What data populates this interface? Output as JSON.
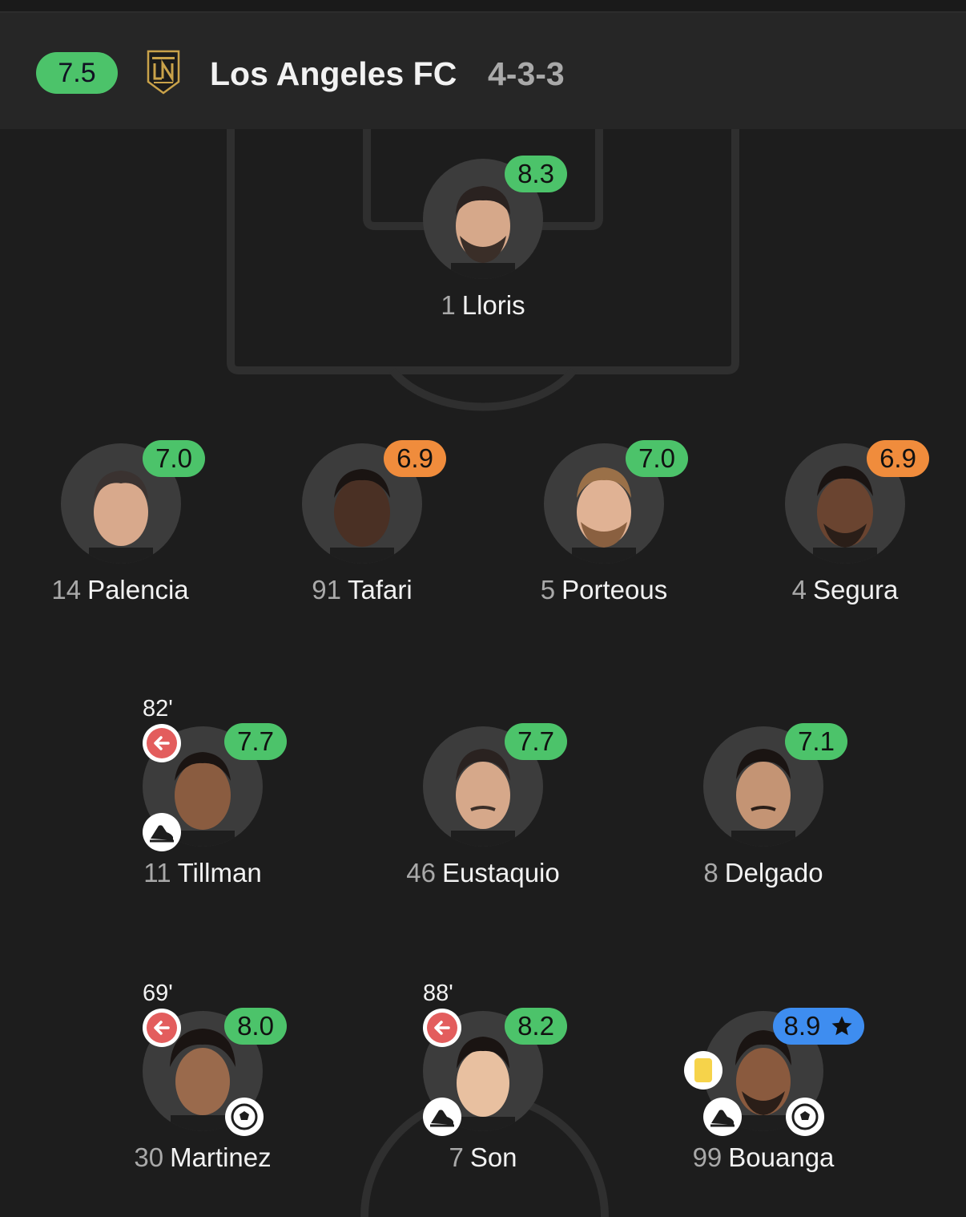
{
  "header": {
    "team_rating": "7.5",
    "team_name": "Los Angeles FC",
    "formation": "4-3-3"
  },
  "colors": {
    "rating_green": "#4cc36a",
    "rating_orange": "#f08c3c",
    "rating_blue": "#3e8df0",
    "sub_red": "#e35d5d",
    "yellow_card": "#f6d34a"
  },
  "players": {
    "lloris": {
      "number": "1",
      "name": "Lloris",
      "rating": "8.3"
    },
    "palencia": {
      "number": "14",
      "name": "Palencia",
      "rating": "7.0"
    },
    "tafari": {
      "number": "91",
      "name": "Tafari",
      "rating": "6.9"
    },
    "porteous": {
      "number": "5",
      "name": "Porteous",
      "rating": "7.0"
    },
    "segura": {
      "number": "4",
      "name": "Segura",
      "rating": "6.9"
    },
    "tillman": {
      "number": "11",
      "name": "Tillman",
      "rating": "7.7",
      "sub_time": "82'"
    },
    "eustaquio": {
      "number": "46",
      "name": "Eustaquio",
      "rating": "7.7"
    },
    "delgado": {
      "number": "8",
      "name": "Delgado",
      "rating": "7.1"
    },
    "martinez": {
      "number": "30",
      "name": "Martinez",
      "rating": "8.0",
      "sub_time": "69'"
    },
    "son": {
      "number": "7",
      "name": "Son",
      "rating": "8.2",
      "sub_time": "88'"
    },
    "bouanga": {
      "number": "99",
      "name": "Bouanga",
      "rating": "8.9"
    }
  },
  "icons": {
    "substitution": "arrow-left-icon",
    "assist": "boot-icon",
    "goal": "football-icon",
    "yellow_card": "yellow-card-icon",
    "man_of_match": "star-icon"
  }
}
